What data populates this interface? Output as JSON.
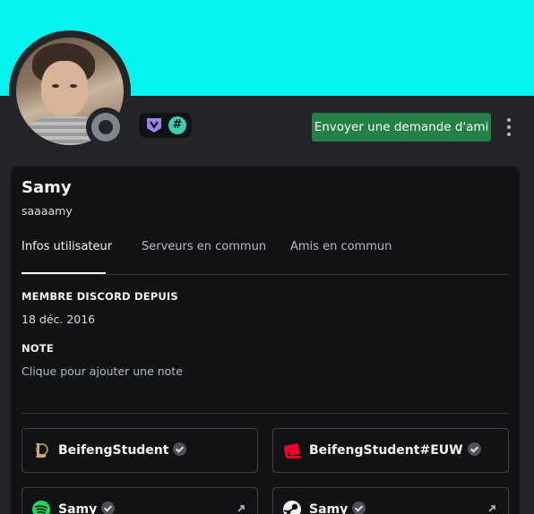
{
  "profile": {
    "banner_color": "#04f3ee",
    "display_name": "Samy",
    "username": "saaaamy",
    "status": "offline",
    "badges": [
      "hypesquad-balance-icon",
      "hashtag-badge-icon"
    ],
    "hash_badge_glyph": "#"
  },
  "actions": {
    "friend_request_label": "Envoyer une demande d'ami",
    "more_label": "more-options-icon"
  },
  "tabs": [
    {
      "label": "Infos utilisateur",
      "active": true
    },
    {
      "label": "Serveurs en commun",
      "active": false
    },
    {
      "label": "Amis en commun",
      "active": false
    }
  ],
  "member_since": {
    "title": "MEMBRE DISCORD DEPUIS",
    "date": "18 déc. 2016"
  },
  "note": {
    "title": "NOTE",
    "placeholder": "Clique pour ajouter une note"
  },
  "connections": [
    {
      "service": "league-of-legends-icon",
      "name": "BeifengStudent",
      "verified": true,
      "external": false
    },
    {
      "service": "riot-games-icon",
      "name": "BeifengStudent#EUW",
      "verified": true,
      "external": false
    },
    {
      "service": "spotify-icon",
      "name": "Samy",
      "verified": true,
      "external": true
    },
    {
      "service": "steam-icon",
      "name": "Samy",
      "verified": true,
      "external": true
    }
  ],
  "colors": {
    "background": "#232428",
    "card": "#111214",
    "button_green": "#248046",
    "accent_cyan": "#04f3ee"
  }
}
